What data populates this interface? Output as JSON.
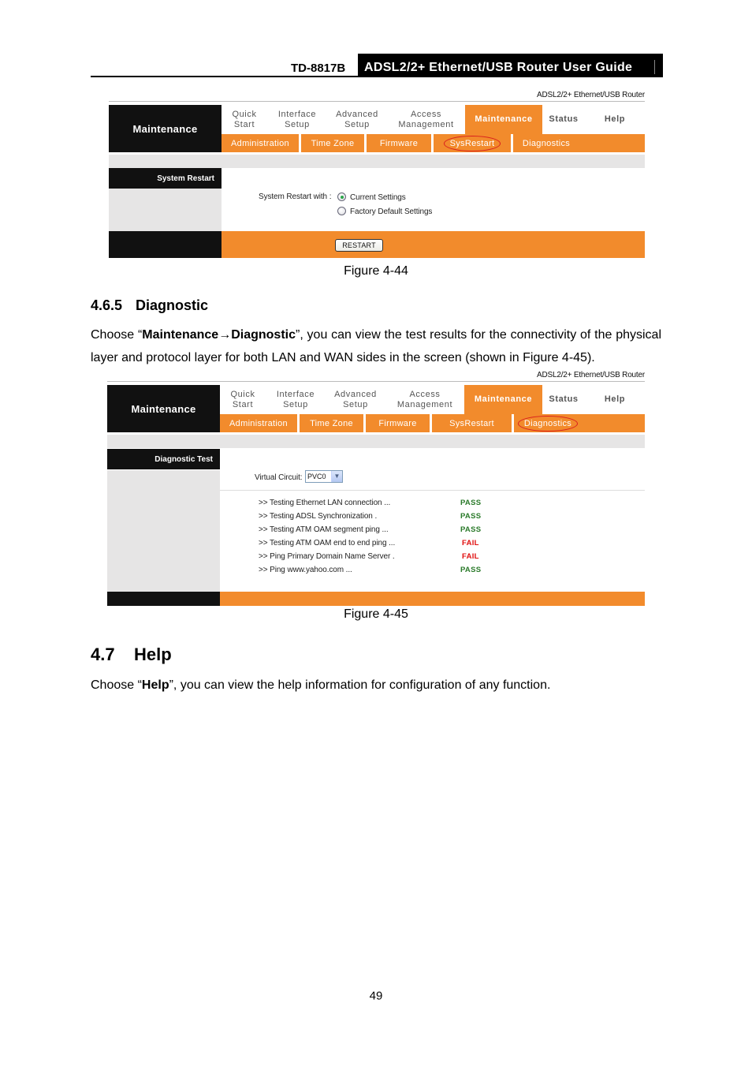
{
  "header": {
    "model": "TD-8817B",
    "guide_title": "ADSL2/2+ Ethernet/USB Router User Guide"
  },
  "router_ui": {
    "brand": "ADSL2/2+ Ethernet/USB Router",
    "section_title": "Maintenance",
    "main_nav": [
      {
        "line1": "Quick",
        "line2": "Start"
      },
      {
        "line1": "Interface",
        "line2": "Setup"
      },
      {
        "line1": "Advanced",
        "line2": "Setup"
      },
      {
        "line1": "Access",
        "line2": "Management"
      },
      {
        "line1": "Maintenance",
        "line2": "",
        "active": true
      },
      {
        "line1": "Status",
        "line2": ""
      },
      {
        "line1": "Help",
        "line2": ""
      }
    ],
    "sub_nav": [
      "Administration",
      "Time Zone",
      "Firmware",
      "SysRestart",
      "Diagnostics"
    ],
    "accent_color": "#f28b2c",
    "highlight_color": "#d81e1e"
  },
  "figure_44": {
    "highlighted_subnav": "SysRestart",
    "section_label": "System Restart",
    "restart_with_label": "System Restart with :",
    "options": [
      {
        "label": "Current Settings",
        "checked": true
      },
      {
        "label": "Factory Default Settings",
        "checked": false
      }
    ],
    "restart_button": "RESTART",
    "caption": "Figure 4-44"
  },
  "section_465": {
    "number": "4.6.5",
    "title": "Diagnostic",
    "para_prefix": "Choose “",
    "para_bold": "Maintenance→Diagnostic",
    "para_suffix": "”, you can view the test results for the connectivity of the physical layer and protocol layer for both LAN and WAN sides in the screen (shown in Figure 4-45)."
  },
  "figure_45": {
    "highlighted_subnav": "Diagnostics",
    "section_label": "Diagnostic Test",
    "virtual_circuit_label": "Virtual Circuit:",
    "virtual_circuit_value": "PVC0",
    "tests": [
      {
        "label": ">> Testing Ethernet LAN connection ...",
        "result": "PASS"
      },
      {
        "label": ">> Testing ADSL Synchronization .",
        "result": "PASS"
      },
      {
        "label": ">> Testing ATM OAM segment ping ...",
        "result": "PASS"
      },
      {
        "label": ">> Testing ATM OAM end to end ping ...",
        "result": "FAIL"
      },
      {
        "label": ">> Ping Primary Domain Name Server .",
        "result": "FAIL"
      },
      {
        "label": ">> Ping www.yahoo.com ...",
        "result": "PASS"
      }
    ],
    "pass_color": "#2a7a2a",
    "fail_color": "#e01010",
    "caption": "Figure 4-45"
  },
  "section_47": {
    "number": "4.7",
    "title": "Help",
    "para_prefix": "Choose “",
    "para_bold": "Help",
    "para_suffix": "”, you can view the help information for configuration of any function."
  },
  "page_number": "49"
}
